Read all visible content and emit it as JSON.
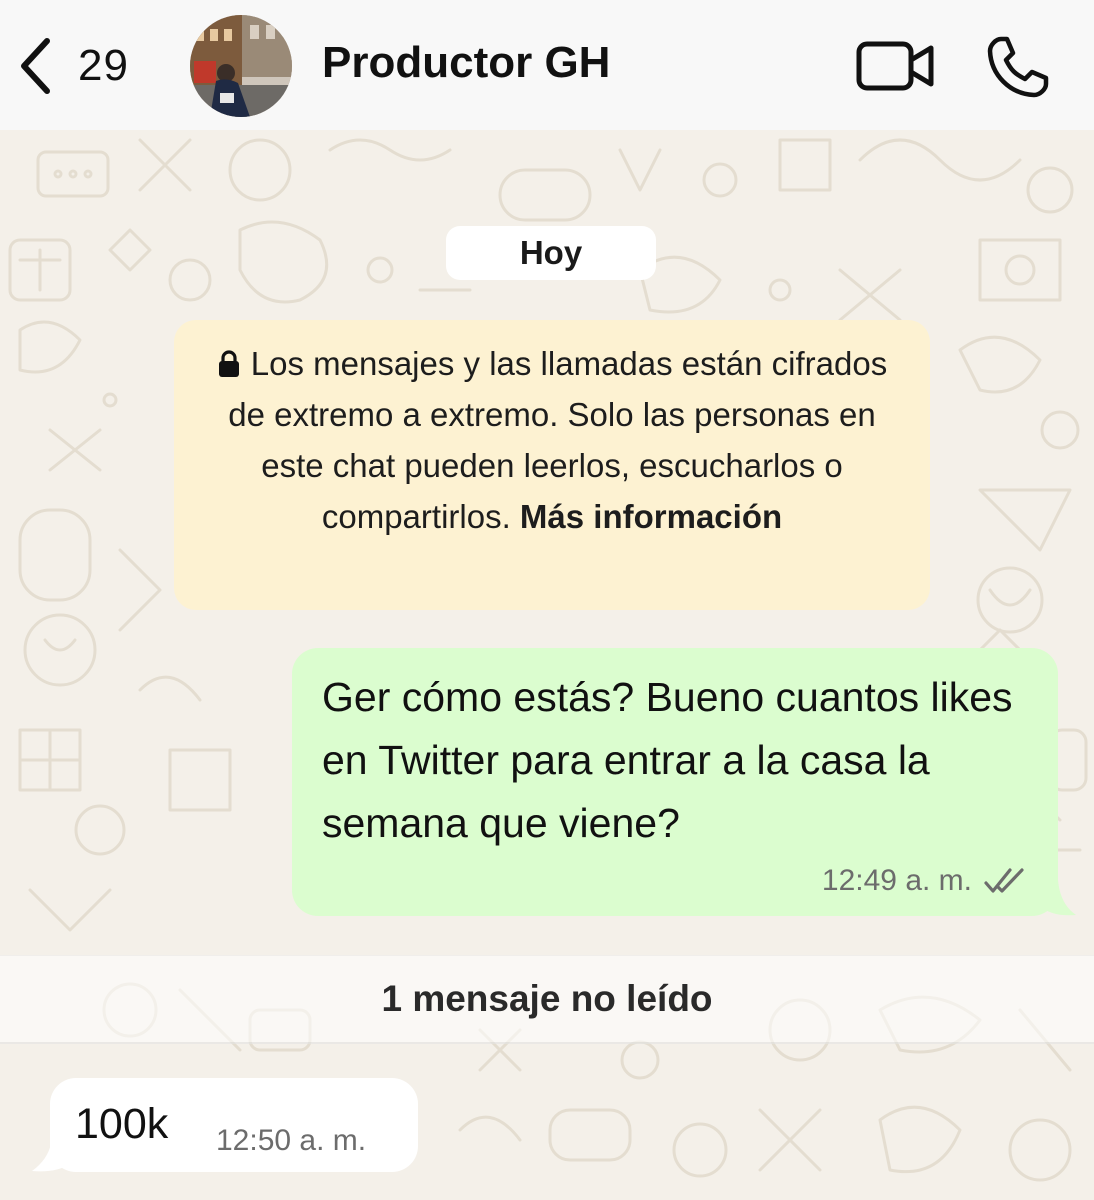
{
  "header": {
    "back_count": "29",
    "contact_name": "Productor GH",
    "icons": {
      "back": "chevron-left-icon",
      "video": "video-camera-icon",
      "call": "phone-icon"
    }
  },
  "chat": {
    "date_label": "Hoy",
    "encryption_notice": {
      "text": "Los mensajes y las llamadas están cifrados de extremo a extremo. Solo las personas en este chat pueden leerlos, escucharlos o compartirlos.",
      "link": "Más información",
      "icon": "lock-icon"
    },
    "messages": [
      {
        "direction": "outgoing",
        "text": "Ger cómo estás? Bueno cuantos likes en Twitter para entrar a la casa la semana que viene?",
        "time": "12:49 a. m.",
        "status": "read-double-check"
      },
      {
        "direction": "incoming",
        "text": "100k",
        "time": "12:50 a. m."
      }
    ],
    "unread_label": "1 mensaje no leído"
  },
  "colors": {
    "outgoing_bubble": "#dbfdcf",
    "incoming_bubble": "#ffffff",
    "notice_bubble": "#fdf2d2",
    "wallpaper": "#f4f0e9",
    "header": "#f8f8f8"
  }
}
